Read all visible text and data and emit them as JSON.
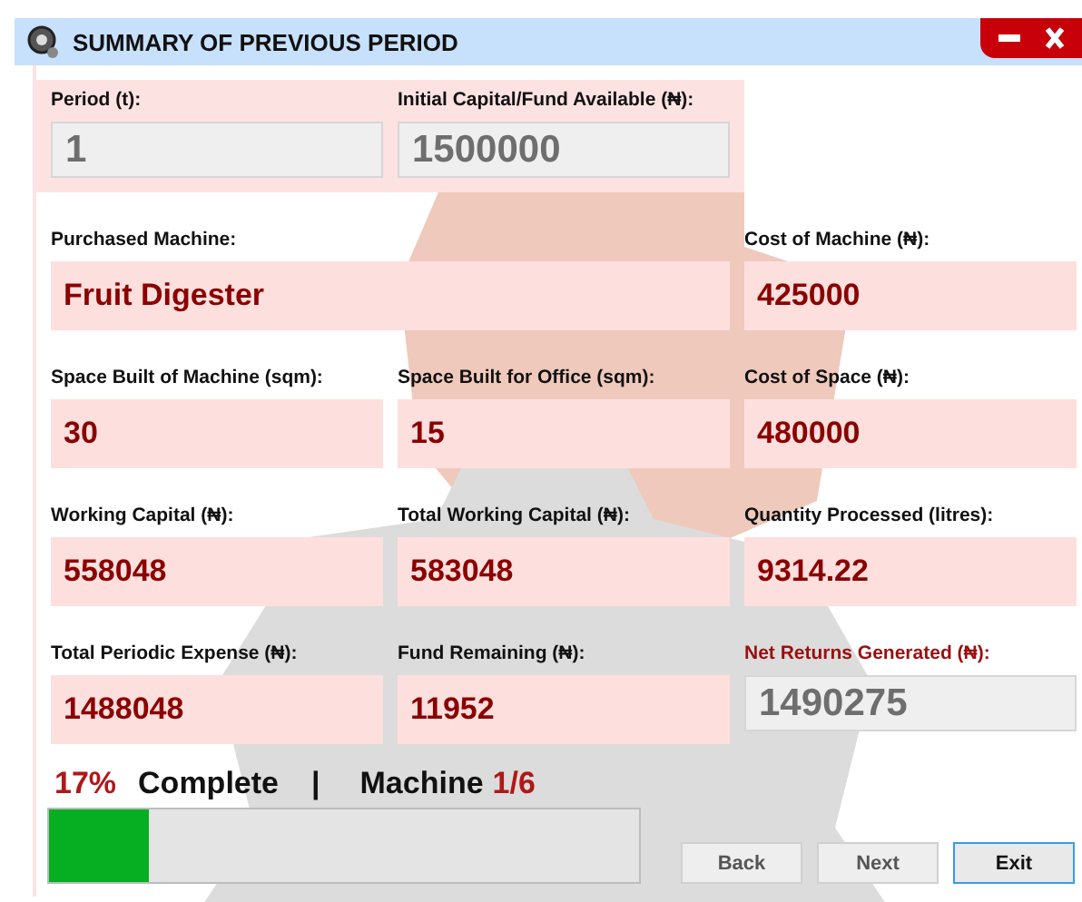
{
  "window": {
    "title": "SUMMARY OF PREVIOUS PERIOD"
  },
  "top_fields": [
    {
      "label": "Period (t):",
      "value": "1",
      "kind": "readonly",
      "label_highlighted": false
    },
    {
      "label": "Initial Capital/Fund Available (₦):",
      "value": "1500000",
      "kind": "readonly",
      "label_highlighted": false
    }
  ],
  "rows": [
    [
      {
        "label": "Purchased Machine:",
        "value": "Fruit Digester",
        "kind": "value",
        "label_highlighted": false
      },
      {
        "label": "Cost of Machine (₦):",
        "value": "425000",
        "kind": "value",
        "label_highlighted": false
      }
    ],
    [
      {
        "label": "Space Built of Machine (sqm):",
        "value": "30",
        "kind": "value",
        "label_highlighted": false
      },
      {
        "label": "Space Built for Office (sqm):",
        "value": "15",
        "kind": "value",
        "label_highlighted": false
      },
      {
        "label": "Cost of Space (₦):",
        "value": "480000",
        "kind": "value",
        "label_highlighted": false
      }
    ],
    [
      {
        "label": "Working Capital (₦):",
        "value": "558048",
        "kind": "value",
        "label_highlighted": false
      },
      {
        "label": "Total Working Capital (₦):",
        "value": "583048",
        "kind": "value",
        "label_highlighted": false
      },
      {
        "label": "Quantity Processed (litres):",
        "value": "9314.22",
        "kind": "value",
        "label_highlighted": false
      }
    ],
    [
      {
        "label": "Total Periodic Expense (₦):",
        "value": "1488048",
        "kind": "value",
        "label_highlighted": false
      },
      {
        "label": "Fund Remaining (₦):",
        "value": "11952",
        "kind": "value",
        "label_highlighted": false
      },
      {
        "label": "Net Returns Generated (₦):",
        "value": "1490275",
        "kind": "readonly",
        "label_highlighted": true
      }
    ]
  ],
  "progress": {
    "percent": "17%",
    "complete_label": "Complete",
    "separator": "|",
    "machine_label": "Machine",
    "machine_count": "1/6",
    "level": 0.17
  },
  "buttons": [
    {
      "label": "Back",
      "focused": false
    },
    {
      "label": "Next",
      "focused": false
    },
    {
      "label": "Exit",
      "focused": true
    }
  ]
}
